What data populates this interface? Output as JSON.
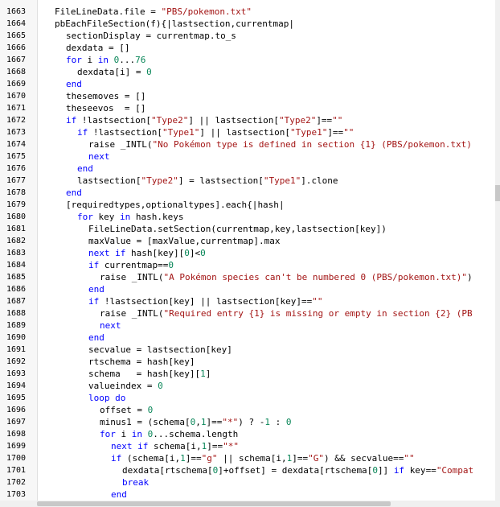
{
  "editor": {
    "lines": [
      {
        "n": "1663",
        "indent": 0,
        "tokens": [
          [
            "id",
            "FileLineData.file "
          ],
          [
            "op",
            "= "
          ],
          [
            "str",
            "\"PBS/pokemon.txt\""
          ]
        ]
      },
      {
        "n": "1664",
        "indent": 0,
        "tokens": [
          [
            "id",
            "pbEachFileSection(f)"
          ],
          [
            "op",
            "{|"
          ],
          [
            "id",
            "lastsection,currentmap"
          ],
          [
            "op",
            "|"
          ]
        ]
      },
      {
        "n": "1665",
        "indent": 1,
        "tokens": [
          [
            "id",
            "sectionDisplay "
          ],
          [
            "op",
            "= "
          ],
          [
            "id",
            "currentmap.to_s"
          ]
        ]
      },
      {
        "n": "1666",
        "indent": 1,
        "tokens": [
          [
            "id",
            "dexdata "
          ],
          [
            "op",
            "= []"
          ]
        ]
      },
      {
        "n": "1667",
        "indent": 1,
        "tokens": [
          [
            "kw",
            "for "
          ],
          [
            "id",
            "i "
          ],
          [
            "kw",
            "in "
          ],
          [
            "num",
            "0"
          ],
          [
            "op",
            "..."
          ],
          [
            "num",
            "76"
          ]
        ]
      },
      {
        "n": "1668",
        "indent": 2,
        "tokens": [
          [
            "id",
            "dexdata"
          ],
          [
            "op",
            "["
          ],
          [
            "id",
            "i"
          ],
          [
            "op",
            "] = "
          ],
          [
            "num",
            "0"
          ]
        ]
      },
      {
        "n": "1669",
        "indent": 1,
        "tokens": [
          [
            "kw",
            "end"
          ]
        ]
      },
      {
        "n": "1670",
        "indent": 1,
        "tokens": [
          [
            "id",
            "thesemoves "
          ],
          [
            "op",
            "= []"
          ]
        ]
      },
      {
        "n": "1671",
        "indent": 1,
        "tokens": [
          [
            "id",
            "theseevos  "
          ],
          [
            "op",
            "= []"
          ]
        ]
      },
      {
        "n": "1672",
        "indent": 1,
        "tokens": [
          [
            "kw",
            "if "
          ],
          [
            "op",
            "!"
          ],
          [
            "id",
            "lastsection"
          ],
          [
            "op",
            "["
          ],
          [
            "str",
            "\"Type2\""
          ],
          [
            "op",
            "] || "
          ],
          [
            "id",
            "lastsection"
          ],
          [
            "op",
            "["
          ],
          [
            "str",
            "\"Type2\""
          ],
          [
            "op",
            "]=="
          ],
          [
            "str",
            "\"\""
          ]
        ]
      },
      {
        "n": "1673",
        "indent": 2,
        "tokens": [
          [
            "kw",
            "if "
          ],
          [
            "op",
            "!"
          ],
          [
            "id",
            "lastsection"
          ],
          [
            "op",
            "["
          ],
          [
            "str",
            "\"Type1\""
          ],
          [
            "op",
            "] || "
          ],
          [
            "id",
            "lastsection"
          ],
          [
            "op",
            "["
          ],
          [
            "str",
            "\"Type1\""
          ],
          [
            "op",
            "]=="
          ],
          [
            "str",
            "\"\""
          ]
        ]
      },
      {
        "n": "1674",
        "indent": 3,
        "tokens": [
          [
            "id",
            "raise _INTL("
          ],
          [
            "str",
            "\"No Pokémon type is defined in section {1} (PBS/pokemon.txt)"
          ]
        ]
      },
      {
        "n": "1675",
        "indent": 3,
        "tokens": [
          [
            "kw",
            "next"
          ]
        ]
      },
      {
        "n": "1676",
        "indent": 2,
        "tokens": [
          [
            "kw",
            "end"
          ]
        ]
      },
      {
        "n": "1677",
        "indent": 2,
        "tokens": [
          [
            "id",
            "lastsection"
          ],
          [
            "op",
            "["
          ],
          [
            "str",
            "\"Type2\""
          ],
          [
            "op",
            "] = "
          ],
          [
            "id",
            "lastsection"
          ],
          [
            "op",
            "["
          ],
          [
            "str",
            "\"Type1\""
          ],
          [
            "op",
            "]."
          ],
          [
            "id",
            "clone"
          ]
        ]
      },
      {
        "n": "1678",
        "indent": 1,
        "tokens": [
          [
            "kw",
            "end"
          ]
        ]
      },
      {
        "n": "1679",
        "indent": 1,
        "tokens": [
          [
            "op",
            "["
          ],
          [
            "id",
            "requiredtypes,optionaltypes"
          ],
          [
            "op",
            "]."
          ],
          [
            "id",
            "each"
          ],
          [
            "op",
            "{|"
          ],
          [
            "id",
            "hash"
          ],
          [
            "op",
            "|"
          ]
        ]
      },
      {
        "n": "1680",
        "indent": 2,
        "tokens": [
          [
            "kw",
            "for "
          ],
          [
            "id",
            "key "
          ],
          [
            "kw",
            "in "
          ],
          [
            "id",
            "hash.keys"
          ]
        ]
      },
      {
        "n": "1681",
        "indent": 3,
        "tokens": [
          [
            "id",
            "FileLineData.setSection(currentmap,key,lastsection"
          ],
          [
            "op",
            "["
          ],
          [
            "id",
            "key"
          ],
          [
            "op",
            "])"
          ]
        ]
      },
      {
        "n": "1682",
        "indent": 3,
        "tokens": [
          [
            "id",
            "maxValue "
          ],
          [
            "op",
            "= ["
          ],
          [
            "id",
            "maxValue,currentmap"
          ],
          [
            "op",
            "]."
          ],
          [
            "id",
            "max"
          ]
        ]
      },
      {
        "n": "1683",
        "indent": 3,
        "tokens": [
          [
            "kw",
            "next if "
          ],
          [
            "id",
            "hash"
          ],
          [
            "op",
            "["
          ],
          [
            "id",
            "key"
          ],
          [
            "op",
            "]["
          ],
          [
            "num",
            "0"
          ],
          [
            "op",
            "]<"
          ],
          [
            "num",
            "0"
          ]
        ]
      },
      {
        "n": "1684",
        "indent": 3,
        "tokens": [
          [
            "kw",
            "if "
          ],
          [
            "id",
            "currentmap"
          ],
          [
            "op",
            "=="
          ],
          [
            "num",
            "0"
          ]
        ]
      },
      {
        "n": "1685",
        "indent": 4,
        "tokens": [
          [
            "id",
            "raise _INTL("
          ],
          [
            "str",
            "\"A Pokémon species can't be numbered 0 (PBS/pokemon.txt)\""
          ],
          [
            "op",
            ")"
          ]
        ]
      },
      {
        "n": "1686",
        "indent": 3,
        "tokens": [
          [
            "kw",
            "end"
          ]
        ]
      },
      {
        "n": "1687",
        "indent": 3,
        "tokens": [
          [
            "kw",
            "if "
          ],
          [
            "op",
            "!"
          ],
          [
            "id",
            "lastsection"
          ],
          [
            "op",
            "["
          ],
          [
            "id",
            "key"
          ],
          [
            "op",
            "] || "
          ],
          [
            "id",
            "lastsection"
          ],
          [
            "op",
            "["
          ],
          [
            "id",
            "key"
          ],
          [
            "op",
            "]=="
          ],
          [
            "str",
            "\"\""
          ]
        ]
      },
      {
        "n": "1688",
        "indent": 4,
        "tokens": [
          [
            "id",
            "raise _INTL("
          ],
          [
            "str",
            "\"Required entry {1} is missing or empty in section {2} (PB"
          ]
        ]
      },
      {
        "n": "1689",
        "indent": 4,
        "tokens": [
          [
            "kw",
            "next"
          ]
        ]
      },
      {
        "n": "1690",
        "indent": 3,
        "tokens": [
          [
            "kw",
            "end"
          ]
        ]
      },
      {
        "n": "1691",
        "indent": 3,
        "tokens": [
          [
            "id",
            "secvalue "
          ],
          [
            "op",
            "= "
          ],
          [
            "id",
            "lastsection"
          ],
          [
            "op",
            "["
          ],
          [
            "id",
            "key"
          ],
          [
            "op",
            "]"
          ]
        ]
      },
      {
        "n": "1692",
        "indent": 3,
        "tokens": [
          [
            "id",
            "rtschema "
          ],
          [
            "op",
            "= "
          ],
          [
            "id",
            "hash"
          ],
          [
            "op",
            "["
          ],
          [
            "id",
            "key"
          ],
          [
            "op",
            "]"
          ]
        ]
      },
      {
        "n": "1693",
        "indent": 3,
        "tokens": [
          [
            "id",
            "schema   "
          ],
          [
            "op",
            "= "
          ],
          [
            "id",
            "hash"
          ],
          [
            "op",
            "["
          ],
          [
            "id",
            "key"
          ],
          [
            "op",
            "]["
          ],
          [
            "num",
            "1"
          ],
          [
            "op",
            "]"
          ]
        ]
      },
      {
        "n": "1694",
        "indent": 3,
        "tokens": [
          [
            "id",
            "valueindex "
          ],
          [
            "op",
            "= "
          ],
          [
            "num",
            "0"
          ]
        ]
      },
      {
        "n": "1695",
        "indent": 3,
        "tokens": [
          [
            "kw",
            "loop do"
          ]
        ]
      },
      {
        "n": "1696",
        "indent": 4,
        "tokens": [
          [
            "id",
            "offset "
          ],
          [
            "op",
            "= "
          ],
          [
            "num",
            "0"
          ]
        ]
      },
      {
        "n": "1697",
        "indent": 4,
        "tokens": [
          [
            "id",
            "minus1 "
          ],
          [
            "op",
            "= ("
          ],
          [
            "id",
            "schema"
          ],
          [
            "op",
            "["
          ],
          [
            "num",
            "0"
          ],
          [
            "op",
            ","
          ],
          [
            "num",
            "1"
          ],
          [
            "op",
            "]=="
          ],
          [
            "str",
            "\"*\""
          ],
          [
            "op",
            ") ? -"
          ],
          [
            "num",
            "1"
          ],
          [
            "op",
            " : "
          ],
          [
            "num",
            "0"
          ]
        ]
      },
      {
        "n": "1698",
        "indent": 4,
        "tokens": [
          [
            "kw",
            "for "
          ],
          [
            "id",
            "i "
          ],
          [
            "kw",
            "in "
          ],
          [
            "num",
            "0"
          ],
          [
            "op",
            "..."
          ],
          [
            "id",
            "schema.length"
          ]
        ]
      },
      {
        "n": "1699",
        "indent": 5,
        "tokens": [
          [
            "kw",
            "next if "
          ],
          [
            "id",
            "schema"
          ],
          [
            "op",
            "["
          ],
          [
            "id",
            "i"
          ],
          [
            "op",
            ","
          ],
          [
            "num",
            "1"
          ],
          [
            "op",
            "]=="
          ],
          [
            "str",
            "\"*\""
          ]
        ]
      },
      {
        "n": "1700",
        "indent": 5,
        "tokens": [
          [
            "kw",
            "if "
          ],
          [
            "op",
            "("
          ],
          [
            "id",
            "schema"
          ],
          [
            "op",
            "["
          ],
          [
            "id",
            "i"
          ],
          [
            "op",
            ","
          ],
          [
            "num",
            "1"
          ],
          [
            "op",
            "]=="
          ],
          [
            "str",
            "\"g\""
          ],
          [
            "op",
            " || "
          ],
          [
            "id",
            "schema"
          ],
          [
            "op",
            "["
          ],
          [
            "id",
            "i"
          ],
          [
            "op",
            ","
          ],
          [
            "num",
            "1"
          ],
          [
            "op",
            "]=="
          ],
          [
            "str",
            "\"G\""
          ],
          [
            "op",
            ") && "
          ],
          [
            "id",
            "secvalue"
          ],
          [
            "op",
            "=="
          ],
          [
            "str",
            "\"\""
          ]
        ]
      },
      {
        "n": "1701",
        "indent": 6,
        "tokens": [
          [
            "id",
            "dexdata"
          ],
          [
            "op",
            "["
          ],
          [
            "id",
            "rtschema"
          ],
          [
            "op",
            "["
          ],
          [
            "num",
            "0"
          ],
          [
            "op",
            "]+"
          ],
          [
            "id",
            "offset"
          ],
          [
            "op",
            "] = "
          ],
          [
            "id",
            "dexdata"
          ],
          [
            "op",
            "["
          ],
          [
            "id",
            "rtschema"
          ],
          [
            "op",
            "["
          ],
          [
            "num",
            "0"
          ],
          [
            "op",
            "]] "
          ],
          [
            "kw",
            "if "
          ],
          [
            "id",
            "key"
          ],
          [
            "op",
            "=="
          ],
          [
            "str",
            "\"Compat"
          ]
        ]
      },
      {
        "n": "1702",
        "indent": 6,
        "tokens": [
          [
            "kw",
            "break"
          ]
        ]
      },
      {
        "n": "1703",
        "indent": 5,
        "tokens": [
          [
            "kw",
            "end"
          ]
        ]
      }
    ]
  }
}
